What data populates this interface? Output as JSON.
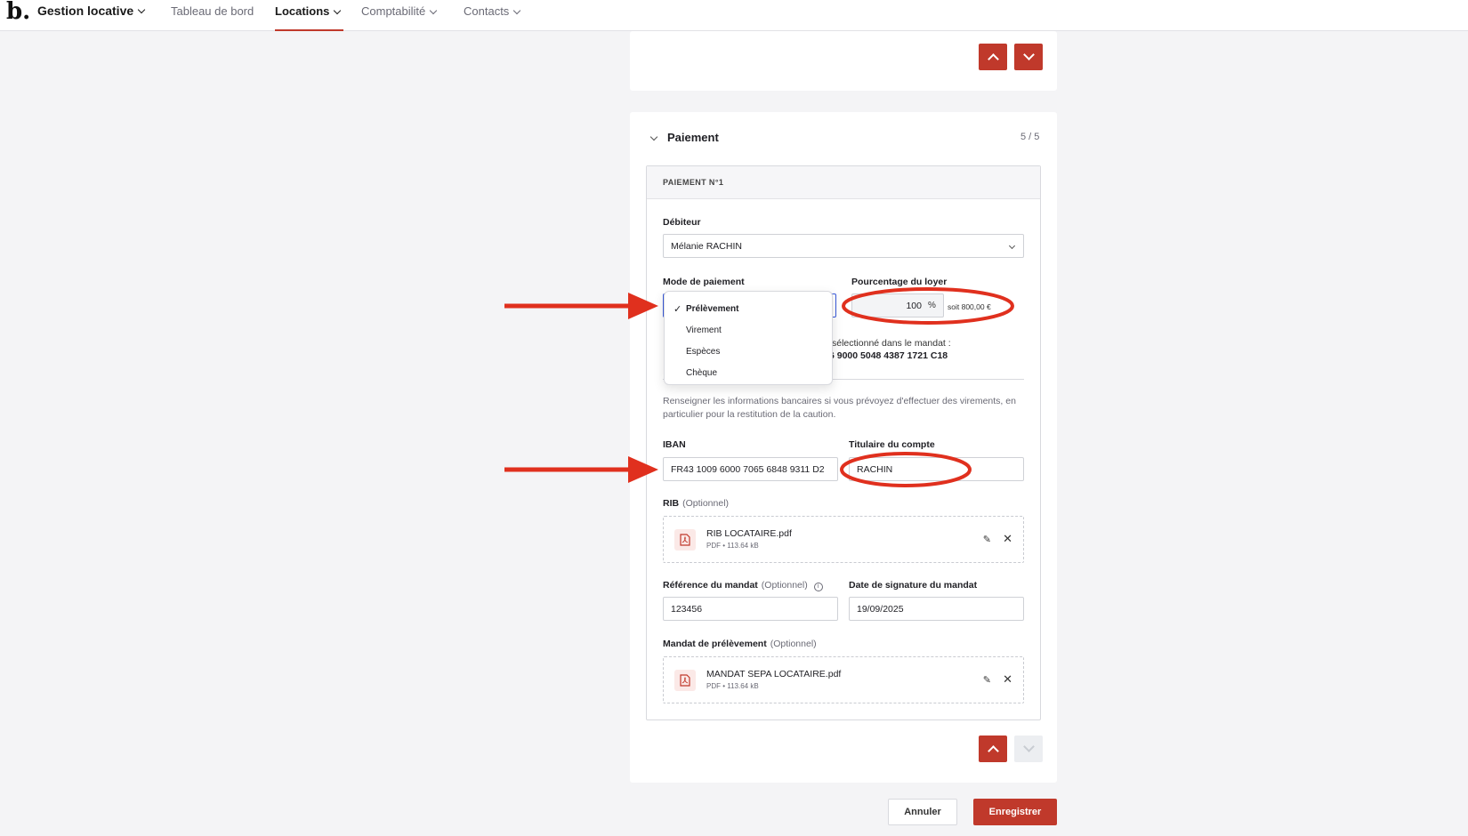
{
  "nav": {
    "logo": "b.",
    "app_name": "Gestion locative",
    "items": [
      {
        "label": "Tableau de bord"
      },
      {
        "label": "Locations"
      },
      {
        "label": "Comptabilité"
      },
      {
        "label": "Contacts"
      }
    ]
  },
  "section": {
    "title": "Paiement",
    "step": "5 / 5"
  },
  "payment": {
    "heading": "PAIEMENT N°1",
    "debtor_label": "Débiteur",
    "debtor_value": "Mélanie RACHIN",
    "mode_label": "Mode de paiement",
    "mode_options": [
      "Prélèvement",
      "Virement",
      "Espèces",
      "Chèque"
    ],
    "percent_label": "Pourcentage du loyer",
    "percent_value": "100",
    "percent_unit": "%",
    "percent_amount": "soit 800,00 €",
    "mandate_note": "sélectionné dans le mandat :",
    "mandate_iban_partial": "6 9000 5048 4387 1721 C18",
    "bank_helper": "Renseigner les informations bancaires si vous prévoyez d'effectuer des virements, en particulier pour la restitution de la caution.",
    "iban_label": "IBAN",
    "iban_value": "FR43 1009 6000 7065 6848 9311 D2",
    "holder_label": "Titulaire du compte",
    "holder_value": "RACHIN",
    "rib_label": "RIB",
    "optional": "(Optionnel)",
    "rib_file": {
      "name": "RIB LOCATAIRE.pdf",
      "meta": "PDF • 113.64 kB"
    },
    "ref_label": "Référence du mandat",
    "ref_value": "123456",
    "date_label": "Date de signature du mandat",
    "date_value": "19/09/2025",
    "mandate_label": "Mandat de prélèvement",
    "mandate_file": {
      "name": "MANDAT SEPA LOCATAIRE.pdf",
      "meta": "PDF • 113.64 kB"
    }
  },
  "actions": {
    "cancel": "Annuler",
    "save": "Enregistrer"
  },
  "colors": {
    "accent": "#c0392b",
    "annotation": "#e0301e"
  }
}
